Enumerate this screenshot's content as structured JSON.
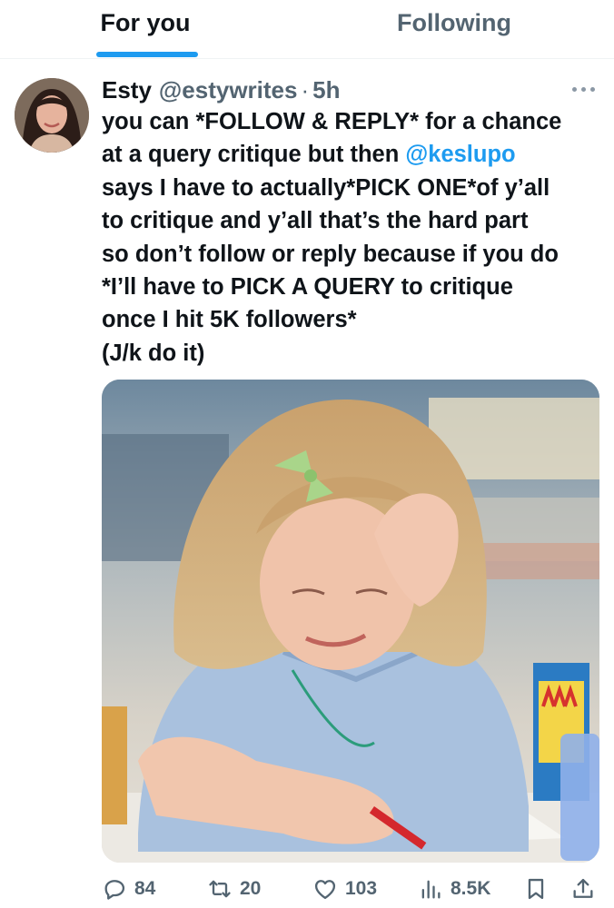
{
  "tabs": [
    {
      "label": "For you",
      "active": true
    },
    {
      "label": "Following",
      "active": false
    }
  ],
  "colors": {
    "accent": "#1d9bf0",
    "text": "#0f1419",
    "muted": "#536471"
  },
  "tweet": {
    "name": "Esty",
    "handle": "@estywrites",
    "separator": "·",
    "time": "5h",
    "text_lines": [
      {
        "before": "you can *FOLLOW & REPLY* for a chance",
        "mention": "",
        "after": ""
      },
      {
        "before": "at a query critique but then ",
        "mention": "@keslupo",
        "after": ""
      },
      {
        "before": "says I have to actually*PICK ONE*of y’all",
        "mention": "",
        "after": ""
      },
      {
        "before": "to critique and y’all that’s the hard part",
        "mention": "",
        "after": ""
      },
      {
        "before": "so don’t follow or reply because if you do",
        "mention": "",
        "after": ""
      },
      {
        "before": "*I’ll have to PICK A QUERY to critique",
        "mention": "",
        "after": ""
      },
      {
        "before": "once I hit 5K followers*",
        "mention": "",
        "after": ""
      },
      {
        "before": "(J/k do it)",
        "mention": "",
        "after": ""
      }
    ],
    "media_description_icon": "photo-crying-girl-drawing"
  },
  "actions": {
    "replies": "84",
    "retweets": "20",
    "likes": "103",
    "views": "8.5K"
  },
  "icons": [
    "reply-icon",
    "retweet-icon",
    "like-icon",
    "views-icon",
    "bookmark-icon",
    "share-icon",
    "more-icon"
  ]
}
